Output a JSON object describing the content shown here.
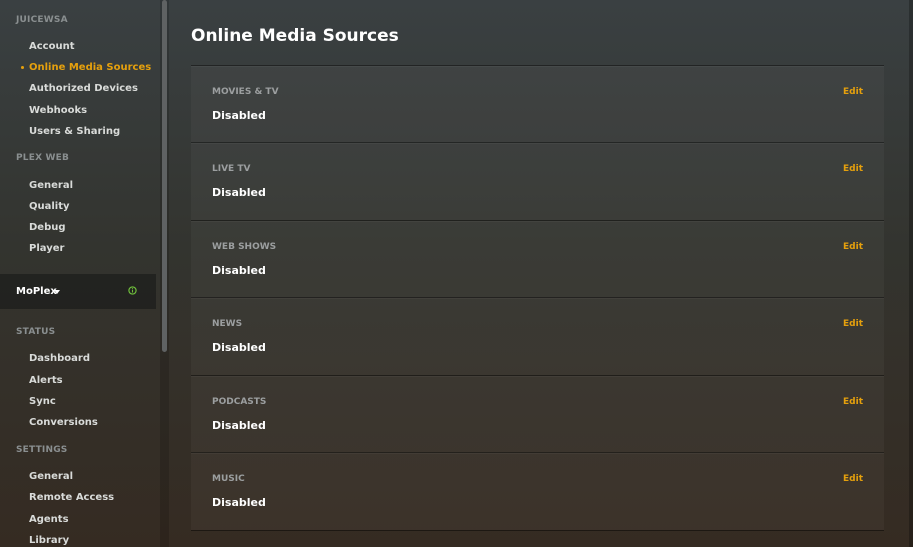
{
  "sidebar": {
    "account_section": {
      "heading": "JUICEWSA",
      "items": [
        {
          "label": "Account"
        },
        {
          "label": "Online Media Sources"
        },
        {
          "label": "Authorized Devices"
        },
        {
          "label": "Webhooks"
        },
        {
          "label": "Users & Sharing"
        }
      ]
    },
    "plexweb_section": {
      "heading": "PLEX WEB",
      "items": [
        {
          "label": "General"
        },
        {
          "label": "Quality"
        },
        {
          "label": "Debug"
        },
        {
          "label": "Player"
        }
      ]
    },
    "server": {
      "name": "MoPlex",
      "status_icon": "info-circle-icon",
      "status_color": "#6fbf3b"
    },
    "status_section": {
      "heading": "STATUS",
      "items": [
        {
          "label": "Dashboard"
        },
        {
          "label": "Alerts"
        },
        {
          "label": "Sync"
        },
        {
          "label": "Conversions"
        }
      ]
    },
    "settings_section": {
      "heading": "SETTINGS",
      "items": [
        {
          "label": "General"
        },
        {
          "label": "Remote Access"
        },
        {
          "label": "Agents"
        },
        {
          "label": "Library"
        }
      ]
    }
  },
  "main": {
    "title": "Online Media Sources",
    "sources": [
      {
        "label": "MOVIES & TV",
        "value": "Disabled",
        "edit": "Edit"
      },
      {
        "label": "LIVE TV",
        "value": "Disabled",
        "edit": "Edit"
      },
      {
        "label": "WEB SHOWS",
        "value": "Disabled",
        "edit": "Edit"
      },
      {
        "label": "NEWS",
        "value": "Disabled",
        "edit": "Edit"
      },
      {
        "label": "PODCASTS",
        "value": "Disabled",
        "edit": "Edit"
      },
      {
        "label": "MUSIC",
        "value": "Disabled",
        "edit": "Edit"
      }
    ]
  },
  "colors": {
    "accent": "#e5a00d",
    "text": "#ffffff",
    "muted": "#8a8f90"
  }
}
